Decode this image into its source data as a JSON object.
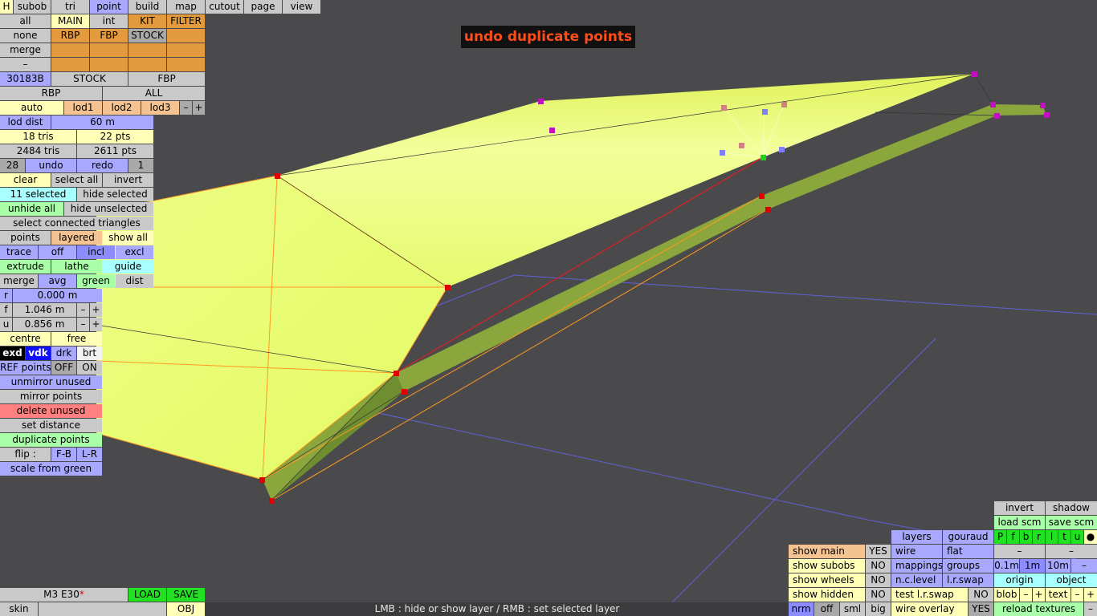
{
  "message": "undo duplicate points",
  "status_bar": "LMB : hide or show layer / RMB : set selected layer",
  "top_menu": [
    "H",
    "subob",
    "tri",
    "point",
    "build",
    "map",
    "cutout",
    "page",
    "view"
  ],
  "active_menu": "point",
  "layer_grid": {
    "row1": [
      "all",
      "MAIN",
      "int",
      "KIT",
      "FILTER"
    ],
    "row2": [
      "none",
      "RBP",
      "FBP",
      "STOCK",
      ""
    ],
    "row3": [
      "merge",
      "",
      "",
      "",
      ""
    ],
    "row4": [
      "–",
      "",
      "",
      "",
      ""
    ]
  },
  "obj_row": [
    "30183B",
    "STOCK",
    "FBP"
  ],
  "rbp_row": [
    "RBP",
    "ALL"
  ],
  "lod_row": [
    "auto",
    "lod1",
    "lod2",
    "lod3",
    "–",
    "+"
  ],
  "lod_dist": {
    "label": "lod dist",
    "value": "60 m"
  },
  "counts": {
    "tris": "18 tris",
    "pts": "22 pts",
    "total_tris": "2484 tris",
    "total_pts": "2611 pts"
  },
  "undo_row": {
    "left": "28",
    "undo": "undo",
    "redo": "redo",
    "right": "1"
  },
  "selection": {
    "clear": "clear",
    "select_all": "select all",
    "invert": "invert",
    "selected": "11 selected",
    "hide_selected": "hide selected",
    "unhide_all": "unhide all",
    "hide_unselected": "hide unselected",
    "connected": "select connected triangles"
  },
  "points_row": [
    "points",
    "layered",
    "show all"
  ],
  "trace_row": [
    "trace",
    "off",
    "incl",
    "excl"
  ],
  "tool_row": [
    "extrude",
    "lathe",
    "guide"
  ],
  "merge_row": [
    "merge",
    "avg",
    "green",
    "dist"
  ],
  "coords": {
    "r": {
      "label": "r",
      "value": "0.000 m"
    },
    "f": {
      "label": "f",
      "value": "1.046 m"
    },
    "u": {
      "label": "u",
      "value": "0.856 m"
    },
    "minus": "–",
    "plus": "+"
  },
  "centre_row": [
    "centre",
    "free"
  ],
  "view_modes": [
    "exd",
    "vdk",
    "drk",
    "brt"
  ],
  "ref_points": [
    "REF points",
    "OFF",
    "ON"
  ],
  "actions": [
    "unmirror unused",
    "mirror points",
    "delete unused",
    "set distance",
    "duplicate points"
  ],
  "flip_row": [
    "flip :",
    "F-B",
    "L-R"
  ],
  "scale_from_green": "scale from green",
  "bottom_left": {
    "car": "M3 E30",
    "star": "*",
    "load": "LOAD",
    "save": "SAVE",
    "skin": "skin",
    "obj": "OBJ"
  },
  "right_panel": {
    "invert": "invert",
    "shadow": "shadow",
    "load_scm": "load scm",
    "save_scm": "save scm",
    "layers": "layers",
    "gouraud": "gouraud",
    "letters": [
      "P",
      "f",
      "b",
      "r",
      "l",
      "t",
      "u",
      "●"
    ],
    "show_main": "show main",
    "show_main_v": "YES",
    "show_subobs": "show subobs",
    "show_subobs_v": "NO",
    "show_wheels": "show wheels",
    "show_wheels_v": "NO",
    "show_hidden": "show hidden",
    "show_hidden_v": "NO",
    "wire": "wire",
    "flat": "flat",
    "mappings": "mappings",
    "groups": "groups",
    "nclevel": "n.c.level",
    "lrswap": "l.r.swap",
    "test_lrswap": "test l.r.swap",
    "test_lrswap_v": "NO",
    "wire_overlay": "wire overlay",
    "wire_overlay_v": "YES",
    "dash": "–",
    "g01": "0.1m",
    "g1": "1m",
    "g10": "10m",
    "origin": "origin",
    "object": "object",
    "blob": "blob",
    "text": "text",
    "minus": "–",
    "plus": "+",
    "nrm": "nrm",
    "off": "off",
    "sml": "sml",
    "big": "big",
    "reload": "reload textures"
  }
}
